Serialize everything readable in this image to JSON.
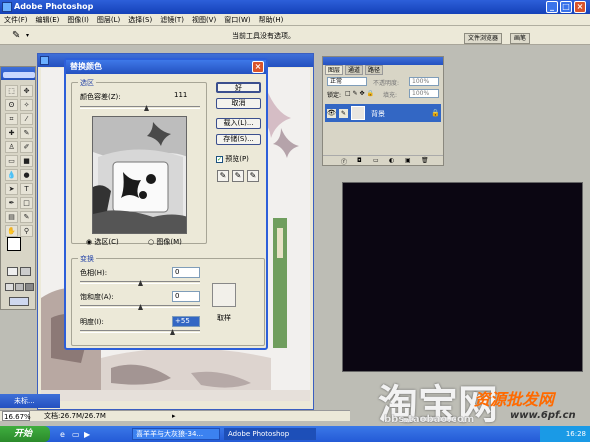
{
  "app": {
    "title": "Adobe Photoshop"
  },
  "menu": [
    "文件(F)",
    "编辑(E)",
    "图像(I)",
    "图层(L)",
    "选择(S)",
    "滤镜(T)",
    "视图(V)",
    "窗口(W)",
    "帮助(H)"
  ],
  "options_bar": {
    "message": "当前工具没有选项。",
    "tabs": [
      "文件浏览器",
      "画笔"
    ]
  },
  "document": {
    "tab_label": "未标..."
  },
  "dialog": {
    "title": "替换颜色",
    "selection_group": "选区",
    "fuzziness_label": "颜色容差(Z):",
    "fuzziness_value": "111",
    "fuzziness": 0.55,
    "radio_selection": "选区(C)",
    "radio_image": "图像(M)",
    "buttons": {
      "ok": "好",
      "cancel": "取消",
      "load": "载入(L)...",
      "save": "存储(S)..."
    },
    "preview_label": "预览(P)",
    "transform_group": "变换",
    "hue_label": "色相(H):",
    "hue_value": "0",
    "saturation_label": "饱和度(A):",
    "saturation_value": "0",
    "lightness_label": "明度(I):",
    "lightness_value": "+55",
    "sample_label": "取样"
  },
  "layers_panel": {
    "tabs": [
      "图层",
      "通道",
      "路径"
    ],
    "blend_mode": "正常",
    "opacity_label": "不透明度:",
    "opacity_value": "100%",
    "lock_label": "锁定:",
    "fill_label": "填充:",
    "fill_value": "100%",
    "layer_name": "背景"
  },
  "status_bar": {
    "zoom": "16.67%",
    "doc_info": "文档:26.7M/26.7M"
  },
  "taskbar": {
    "start_label": "开始",
    "items": [
      "喜羊羊与大灰狼-34...",
      "Adobe Photoshop"
    ],
    "clock": "16:28"
  },
  "watermarks": {
    "taobao": "淘宝网",
    "taobao_url": "bbs.taobao.com",
    "site": "资源批发网",
    "site_url": "www.6pf.cn"
  }
}
